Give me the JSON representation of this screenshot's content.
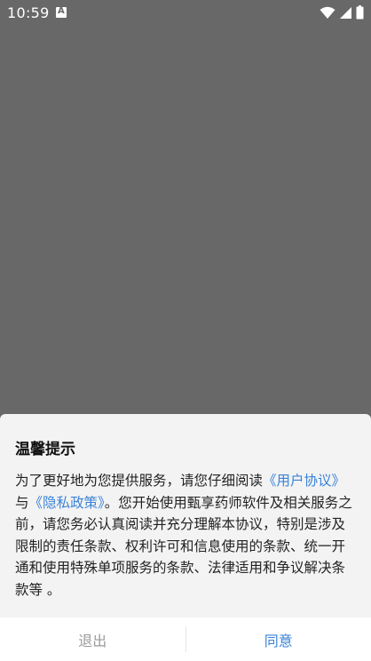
{
  "status_bar": {
    "time": "10:59",
    "icons": [
      "app-notification-icon",
      "wifi-icon",
      "cellular-signal-icon",
      "battery-icon"
    ]
  },
  "dialog": {
    "title": "温馨提示",
    "body": {
      "part1": "为了更好地为您提供服务，请您仔细阅读",
      "link_user_agreement": "《用户协议》",
      "part2": "与",
      "link_privacy_policy": "《隐私政策》",
      "part3": "。您开始使用甄享药师软件及相关服务之前，请您务必认真阅读并充分理解本协议，特别是涉及限制的责任条款、权利许可和信息使用的条款、统一开通和使用特殊单项服务的条款、法律适用和争议解决条款等 。"
    },
    "buttons": {
      "exit": "退出",
      "agree": "同意"
    }
  },
  "colors": {
    "overlay": "#686868",
    "sheet_background": "#f3f3f3",
    "link": "#3a83d8",
    "exit_text": "#9a9a9a",
    "agree_text": "#3a83d8"
  }
}
